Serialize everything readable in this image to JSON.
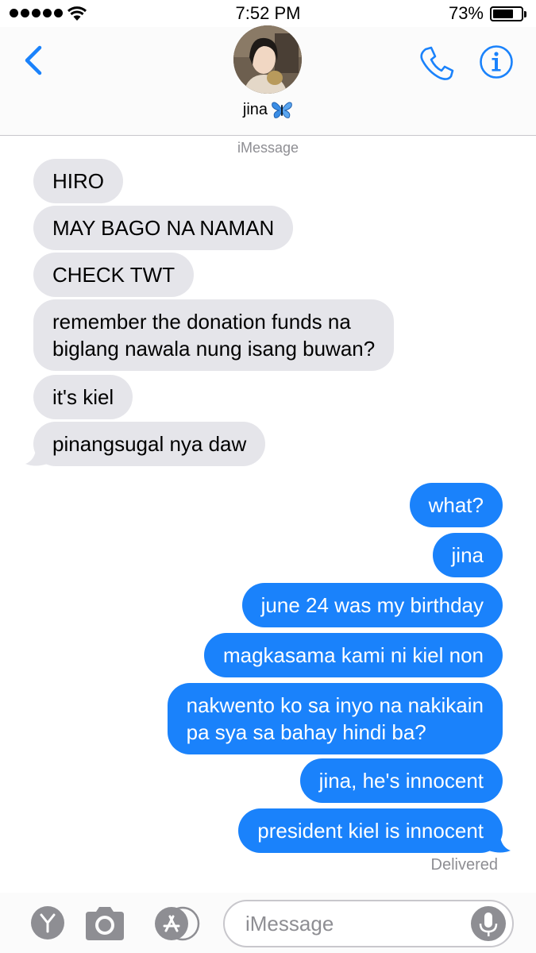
{
  "status": {
    "time": "7:52 PM",
    "battery": "73%",
    "battery_fraction": 0.73
  },
  "header": {
    "contact_name": "jina",
    "name_emoji": "butterfly-icon"
  },
  "thread": {
    "service": "iMessage",
    "incoming": [
      "HIRO",
      "MAY BAGO NA NAMAN",
      "CHECK TWT",
      "remember the donation funds na",
      "biglang nawala nung isang buwan?",
      "it's kiel",
      "pinangsugal nya daw"
    ],
    "outgoing": [
      "what?",
      "jina",
      "june 24 was my birthday",
      "magkasama kami ni kiel non",
      "nakwento ko sa inyo na nakikain",
      "pa sya sa bahay hindi ba?",
      "jina, he's innocent",
      "president kiel is innocent"
    ],
    "delivered": "Delivered"
  },
  "composer": {
    "placeholder": "iMessage"
  },
  "colors": {
    "accent": "#1a82fb",
    "incoming_bubble": "#e5e5ea",
    "muted": "#8e8e93"
  }
}
